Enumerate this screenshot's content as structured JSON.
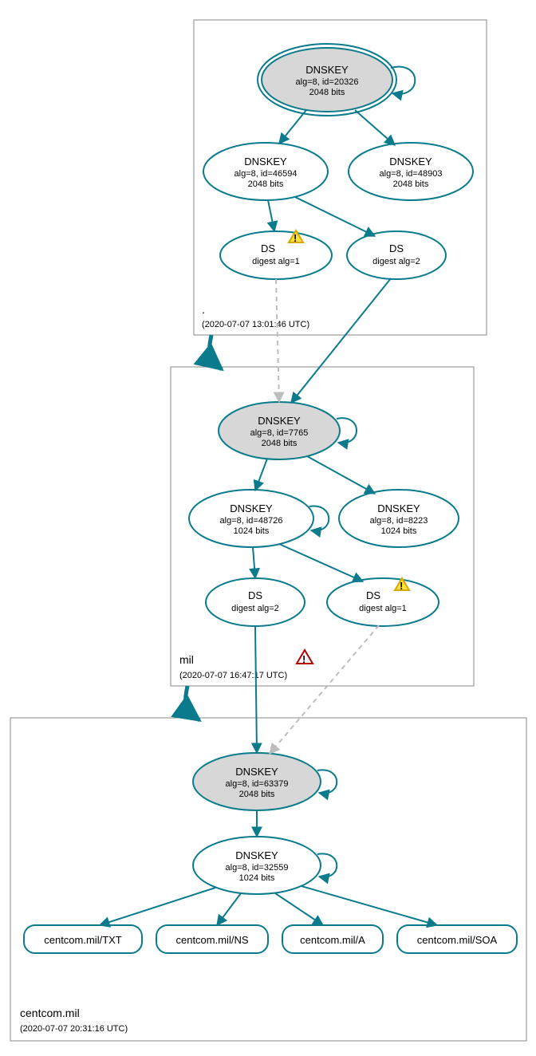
{
  "zones": {
    "root": {
      "name": ".",
      "timestamp": "(2020-07-07 13:01:46 UTC)"
    },
    "mil": {
      "name": "mil",
      "timestamp": "(2020-07-07 16:47:17 UTC)"
    },
    "centcom": {
      "name": "centcom.mil",
      "timestamp": "(2020-07-07 20:31:16 UTC)"
    }
  },
  "nodes": {
    "k20326": {
      "title": "DNSKEY",
      "line2": "alg=8, id=20326",
      "line3": "2048 bits"
    },
    "k46594": {
      "title": "DNSKEY",
      "line2": "alg=8, id=46594",
      "line3": "2048 bits"
    },
    "k48903": {
      "title": "DNSKEY",
      "line2": "alg=8, id=48903",
      "line3": "2048 bits"
    },
    "ds_root_1": {
      "title": "DS",
      "line2": "digest alg=1"
    },
    "ds_root_2": {
      "title": "DS",
      "line2": "digest alg=2"
    },
    "k7765": {
      "title": "DNSKEY",
      "line2": "alg=8, id=7765",
      "line3": "2048 bits"
    },
    "k48726": {
      "title": "DNSKEY",
      "line2": "alg=8, id=48726",
      "line3": "1024 bits"
    },
    "k8223": {
      "title": "DNSKEY",
      "line2": "alg=8, id=8223",
      "line3": "1024 bits"
    },
    "ds_mil_2": {
      "title": "DS",
      "line2": "digest alg=2"
    },
    "ds_mil_1": {
      "title": "DS",
      "line2": "digest alg=1"
    },
    "k63379": {
      "title": "DNSKEY",
      "line2": "alg=8, id=63379",
      "line3": "2048 bits"
    },
    "k32559": {
      "title": "DNSKEY",
      "line2": "alg=8, id=32559",
      "line3": "1024 bits"
    },
    "rr_txt": {
      "title": "centcom.mil/TXT"
    },
    "rr_ns": {
      "title": "centcom.mil/NS"
    },
    "rr_a": {
      "title": "centcom.mil/A"
    },
    "rr_soa": {
      "title": "centcom.mil/SOA"
    }
  }
}
